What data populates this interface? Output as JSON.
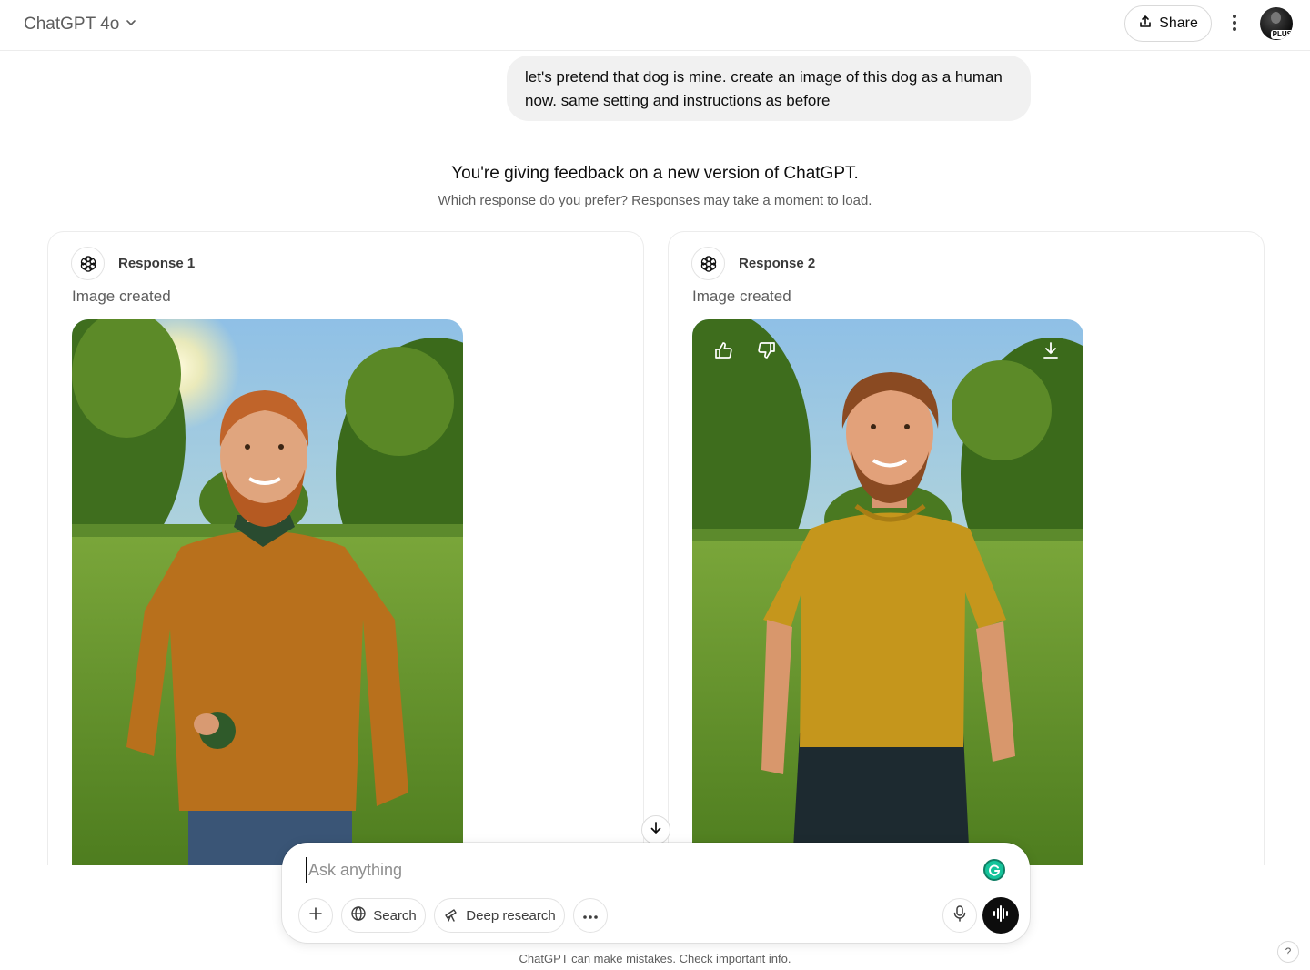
{
  "header": {
    "model_name": "ChatGPT 4o",
    "share_label": "Share",
    "avatar_badge": "PLUS"
  },
  "conversation": {
    "user_message": "let's pretend that dog is mine. create an image of this dog as a human now. same setting and instructions as before"
  },
  "comparison": {
    "title": "You're giving feedback on a new version of ChatGPT.",
    "subtitle": "Which response do you prefer? Responses may take a moment to load.",
    "responses": [
      {
        "label": "Response 1",
        "status": "Image created",
        "image": "man-orange-sweater-holding-ball-in-park"
      },
      {
        "label": "Response 2",
        "status": "Image created",
        "image": "man-mustard-tshirt-walking-in-park"
      }
    ]
  },
  "composer": {
    "placeholder": "Ask anything",
    "tools": {
      "search": "Search",
      "deep_research": "Deep research"
    }
  },
  "footer": {
    "disclaimer": "ChatGPT can make mistakes. Check important info.",
    "help": "?"
  },
  "colors": {
    "voice_button": "#0d0d0d",
    "user_bubble": "#f1f1f1",
    "grammarly": "#15c39a"
  },
  "icons": [
    "chevron-down-icon",
    "share-icon",
    "kebab-menu-icon",
    "openai-logo-icon",
    "thumbs-up-icon",
    "thumbs-down-icon",
    "download-icon",
    "arrow-down-icon",
    "plus-icon",
    "globe-icon",
    "telescope-icon",
    "ellipsis-icon",
    "microphone-icon",
    "voice-wave-icon",
    "grammarly-icon"
  ]
}
